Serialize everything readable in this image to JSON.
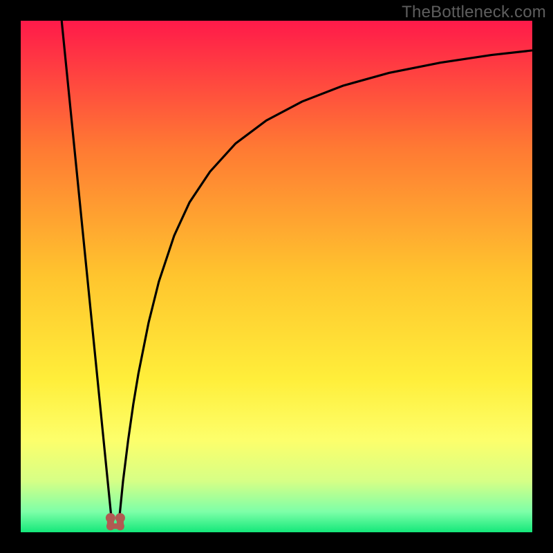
{
  "watermark": "TheBottleneck.com",
  "chart_data": {
    "type": "line",
    "title": "",
    "xlabel": "",
    "ylabel": "",
    "xlim": [
      0,
      100
    ],
    "ylim": [
      0,
      100
    ],
    "background": "heat-gradient",
    "series": [
      {
        "name": "left-branch",
        "x": [
          8,
          9,
          10,
          11,
          12,
          13,
          14,
          15,
          16,
          17,
          17.7
        ],
        "y": [
          100,
          90,
          80,
          70,
          60,
          50,
          40,
          30,
          20,
          10,
          3
        ]
      },
      {
        "name": "right-branch",
        "x": [
          19.3,
          20,
          21,
          22,
          23,
          25,
          27,
          30,
          33,
          37,
          42,
          48,
          55,
          63,
          72,
          82,
          92,
          100
        ],
        "y": [
          3,
          10,
          18,
          25,
          31,
          41,
          49,
          58,
          64.5,
          70.5,
          76,
          80.5,
          84.2,
          87.3,
          89.8,
          91.8,
          93.3,
          94.2
        ]
      }
    ],
    "marker": {
      "name": "optimal-point",
      "x": 18.5,
      "y": 2,
      "color": "#b05a52"
    },
    "gradient_stops": [
      {
        "offset": 0,
        "color": "#ff1a4a"
      },
      {
        "offset": 25,
        "color": "#ff7a33"
      },
      {
        "offset": 50,
        "color": "#ffc52e"
      },
      {
        "offset": 70,
        "color": "#ffee3a"
      },
      {
        "offset": 82,
        "color": "#fdff6b"
      },
      {
        "offset": 90,
        "color": "#d6ff86"
      },
      {
        "offset": 96,
        "color": "#7dffa8"
      },
      {
        "offset": 100,
        "color": "#14e87a"
      }
    ]
  }
}
